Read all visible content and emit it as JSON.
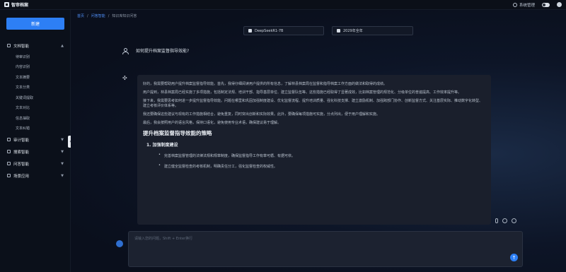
{
  "topbar": {
    "brand": "智审档案",
    "settings_label": "系统管理",
    "colors": {
      "accent": "#2d7ff5"
    }
  },
  "sidebar": {
    "new_button": "新建",
    "groups": [
      {
        "label": "文档智能",
        "items": [
          "待审识别",
          "内容识别",
          "文本摘要",
          "文本分类",
          "关键词提取",
          "文本对比",
          "信息抽取",
          "文本纠错"
        ]
      },
      {
        "label": "审计智能"
      },
      {
        "label": "搜索智能"
      },
      {
        "label": "问答智能"
      },
      {
        "label": "场景应用"
      }
    ]
  },
  "breadcrumb": [
    "首页",
    "问答智能",
    "知识库知识问答"
  ],
  "models": {
    "left": "DeepSeekR1-7B",
    "right": "2029年全年"
  },
  "question": "如何提升档案监督指导效能?",
  "answer": {
    "paragraphs": [
      "好的，我需要帮助用户提升档案监督指导效能。首先，我得仔细阅读用户提供的所有信息，了解林县档案局在监督和指导档案工作方面的做法和取得的成绩。",
      "用户提到，林县档案局已经实施了多项措施，包括制定法规、培训干部、指导基层单位、建立监督队伍等。这些措施已经取得了显著成效，比如档案管理的规范化、分级单位的普遍提高、工作效率提升等。",
      "接下来，我需要思考如何进一步提升监督指导效能。问题在哪里和巩固加强制度建设、优化监督流程、提升培训质量、强化科技支撑、建立激励机制、加强跨部门协作、创新监督方式、关注基层实际、推动数字化转型、建立考核评价体系等。",
      "我还要确保这些建议与现有的工作措施相结合，避免重复，同时突出创新和实际效果。此外，要确保每项措施可实施，分点列出，便于用户理解和实施。",
      "最后，我会按照用户的语言风格，保持口语化，避免使用专业术语，确保建议易于理解。"
    ],
    "heading": "提升档案监督指导效能的策略",
    "subheading": "1.  加强制度建设",
    "bullets": [
      "完善档案监督管理的法律法规和规章制度，确保监督指导工作有章可循、有据可依。",
      "建立健全监督检查的考核机制，明确责任分工，强化监督检查的权威性。"
    ]
  },
  "input": {
    "placeholder": "请输入您的问题，Shift + Enter换行"
  }
}
